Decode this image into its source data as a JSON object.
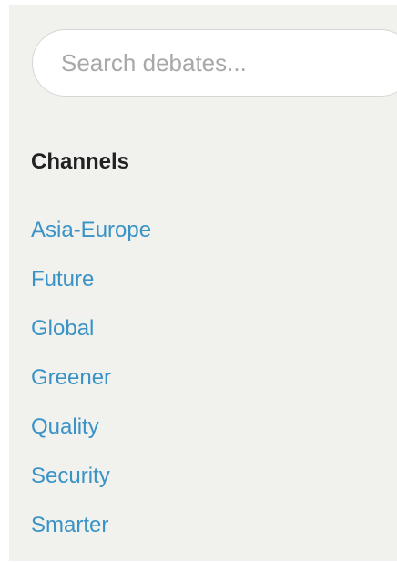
{
  "search": {
    "placeholder": "Search debates..."
  },
  "channels": {
    "heading": "Channels",
    "items": [
      {
        "label": "Asia-Europe"
      },
      {
        "label": "Future"
      },
      {
        "label": "Global"
      },
      {
        "label": "Greener"
      },
      {
        "label": "Quality"
      },
      {
        "label": "Security"
      },
      {
        "label": "Smarter"
      }
    ]
  },
  "colors": {
    "sidebar_background": "#f1f1ee",
    "link": "#3a93c6",
    "heading": "#222222",
    "placeholder": "#a8a8a8"
  }
}
